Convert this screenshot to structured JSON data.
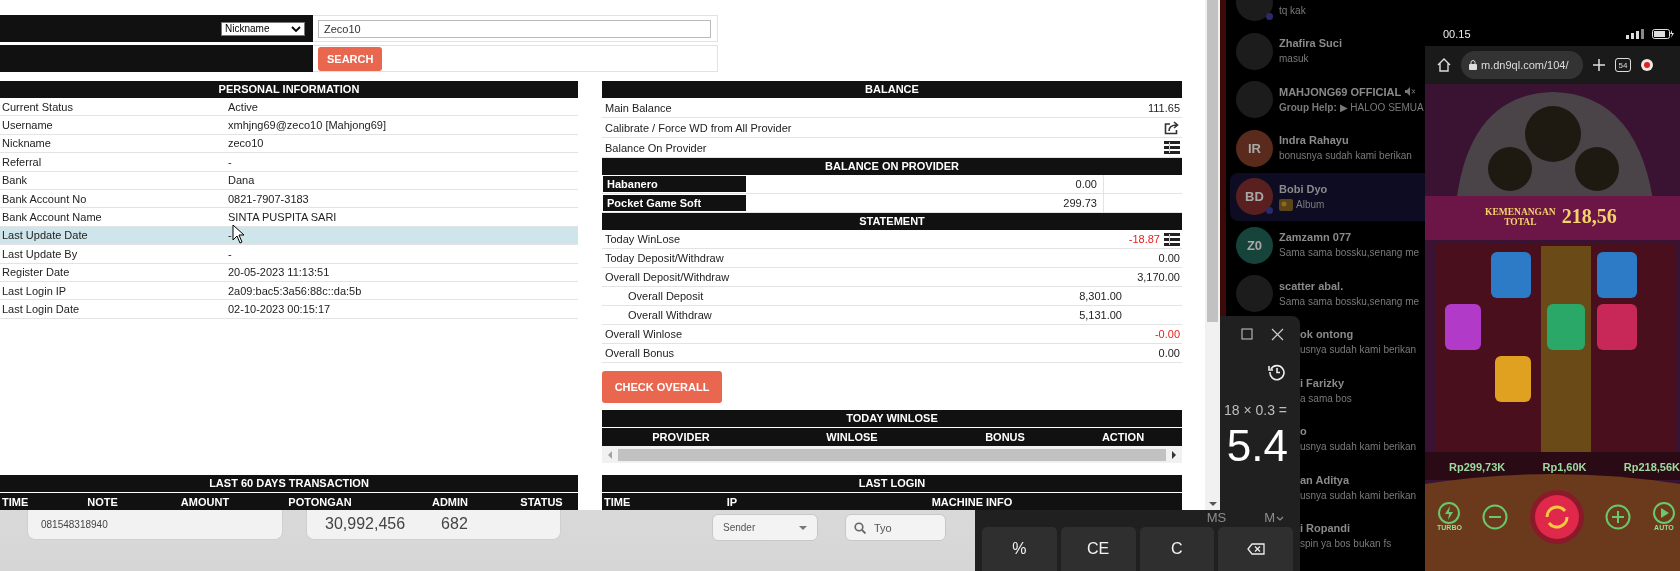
{
  "admin_window": {
    "search": {
      "filter": "Nickname",
      "value": "Zeco10",
      "button": "SEARCH"
    },
    "personal_information": {
      "title": "PERSONAL INFORMATION",
      "rows": [
        {
          "label": "Current Status",
          "value": "Active",
          "selected": false
        },
        {
          "label": "Username",
          "value": "xmhjng69@zeco10  [Mahjong69]",
          "selected": false
        },
        {
          "label": "Nickname",
          "value": "zeco10",
          "selected": false
        },
        {
          "label": "Referral",
          "value": "-",
          "selected": false
        },
        {
          "label": "Bank",
          "value": "Dana",
          "selected": false
        },
        {
          "label": "Bank Account No",
          "value": "0821-7907-3183",
          "selected": false
        },
        {
          "label": "Bank Account Name",
          "value": "SINTA PUSPITA SARI",
          "selected": false
        },
        {
          "label": "Last Update Date",
          "value": "-",
          "selected": true
        },
        {
          "label": "Last Update By",
          "value": "-",
          "selected": false
        },
        {
          "label": "Register Date",
          "value": "20-05-2023 11:13:51",
          "selected": false
        },
        {
          "label": "Last Login IP",
          "value": "2a09:bac5:3a56:88c::da:5b",
          "selected": false
        },
        {
          "label": "Last Login Date",
          "value": "02-10-2023 00:15:17",
          "selected": false
        }
      ]
    },
    "balance": {
      "title": "BALANCE",
      "rows": [
        {
          "kind": "value",
          "label": "Main Balance",
          "value": "111.65"
        },
        {
          "kind": "share",
          "label": "Calibrate / Force WD from All Provider"
        },
        {
          "kind": "list",
          "label": "Balance On Provider"
        }
      ]
    },
    "balance_on_provider": {
      "title": "BALANCE ON PROVIDER",
      "rows": [
        {
          "provider": "Habanero",
          "value": "0.00"
        },
        {
          "provider": "Pocket Game Soft",
          "value": "299.73"
        }
      ]
    },
    "statement": {
      "title": "STATEMENT",
      "rows": [
        {
          "kind": "main",
          "label": "Today WinLose",
          "value": "-18.87",
          "negative": true,
          "menu": true
        },
        {
          "kind": "main",
          "label": "Today Deposit/Withdraw",
          "value": "0.00",
          "negative": false,
          "menu": false
        },
        {
          "kind": "main",
          "label": "Overall Deposit/Withdraw",
          "value": "3,170.00",
          "negative": false,
          "menu": false
        },
        {
          "kind": "sub",
          "label": "Overall Deposit",
          "value": "8,301.00",
          "negative": false,
          "menu": false
        },
        {
          "kind": "sub",
          "label": "Overall Withdraw",
          "value": "5,131.00",
          "negative": false,
          "menu": false
        },
        {
          "kind": "main",
          "label": "Overall Winlose",
          "value": "-0.00",
          "negative": true,
          "menu": false
        },
        {
          "kind": "main",
          "label": "Overall Bonus",
          "value": "0.00",
          "negative": false,
          "menu": false
        }
      ]
    },
    "check_button": "CHECK OVERALL",
    "today_winlose": {
      "title": "TODAY WINLOSE",
      "columns": [
        "PROVIDER",
        "WINLOSE",
        "BONUS",
        "ACTION"
      ]
    },
    "last_60_days": {
      "title": "LAST 60 DAYS TRANSACTION",
      "columns": [
        "TIME",
        "NOTE",
        "AMOUNT",
        "POTONGAN",
        "ADMIN",
        "STATUS"
      ]
    },
    "last_login": {
      "title": "LAST LOGIN",
      "columns": [
        "TIME",
        "IP",
        "MACHINE INFO"
      ]
    }
  },
  "background_app": {
    "phone_field": "081548318940",
    "amount": "30,992,456",
    "count": "682",
    "sender_select": "Sender",
    "search_value": "Tyo"
  },
  "chat_list": [
    {
      "kind": "full",
      "message": "tq kak",
      "online": true,
      "selected": false
    },
    {
      "kind": "full",
      "name": "Zhafira Suci",
      "message": "masuk",
      "selected": false
    },
    {
      "kind": "full",
      "name": "MAHJONG69 OFFICIAL",
      "muted": true,
      "message": "**Group Help:** ▶ HALOO SEMUA",
      "selected": false
    },
    {
      "kind": "full",
      "initials": "IR",
      "color": "#5a2a1c",
      "name": "Indra Rahayu",
      "message": "bonusnya sudah kami berikan",
      "selected": false
    },
    {
      "kind": "full",
      "initials": "BD",
      "color": "#5a2020",
      "name": "Bobi Dyo",
      "message": "Album",
      "thumbnail": true,
      "online": true,
      "selected": true
    },
    {
      "kind": "full",
      "initials": "Z0",
      "color": "#16443a",
      "name": "Zamzamn 077",
      "message": "Sama sama bossku,senang me",
      "selected": false
    },
    {
      "kind": "full",
      "name": "scatter abal.",
      "message": "Sama sama bossku,senang me",
      "selected": false
    },
    {
      "kind": "covered",
      "name": "ok ontong",
      "message": "usnya sudah kami berikan",
      "selected": false
    },
    {
      "kind": "covered",
      "name": "i Farizky",
      "message": "a sama bos",
      "selected": false
    },
    {
      "kind": "covered",
      "name": "o",
      "message": "usnya sudah kami berikan",
      "selected": false
    },
    {
      "kind": "covered",
      "name": "an Aditya",
      "message": "usnya sudah kami berikan",
      "selected": false
    },
    {
      "kind": "covered",
      "name": "i Ropandi",
      "message": "spin ya bos bukan fs",
      "selected": false
    }
  ],
  "calculator": {
    "expression": "18 × 0.3 =",
    "result": "5.4",
    "memory": [
      "MS",
      "M"
    ],
    "keys": [
      {
        "kind": "text",
        "label": "%"
      },
      {
        "kind": "text",
        "label": "CE"
      },
      {
        "kind": "text",
        "label": "C"
      },
      {
        "kind": "backspace"
      }
    ]
  },
  "phone": {
    "time": "00.15",
    "url": "m.dn9ql.com/104/",
    "tab_count": "54",
    "game": {
      "win_label": "KEMENANGAN",
      "win_label_2": "TOTAL",
      "win_amount": "218,56",
      "balances": [
        "Rp299,73K",
        "Rp1,60K",
        "Rp218,56K"
      ],
      "turbo": "TURBO",
      "auto": "AUTO"
    }
  }
}
